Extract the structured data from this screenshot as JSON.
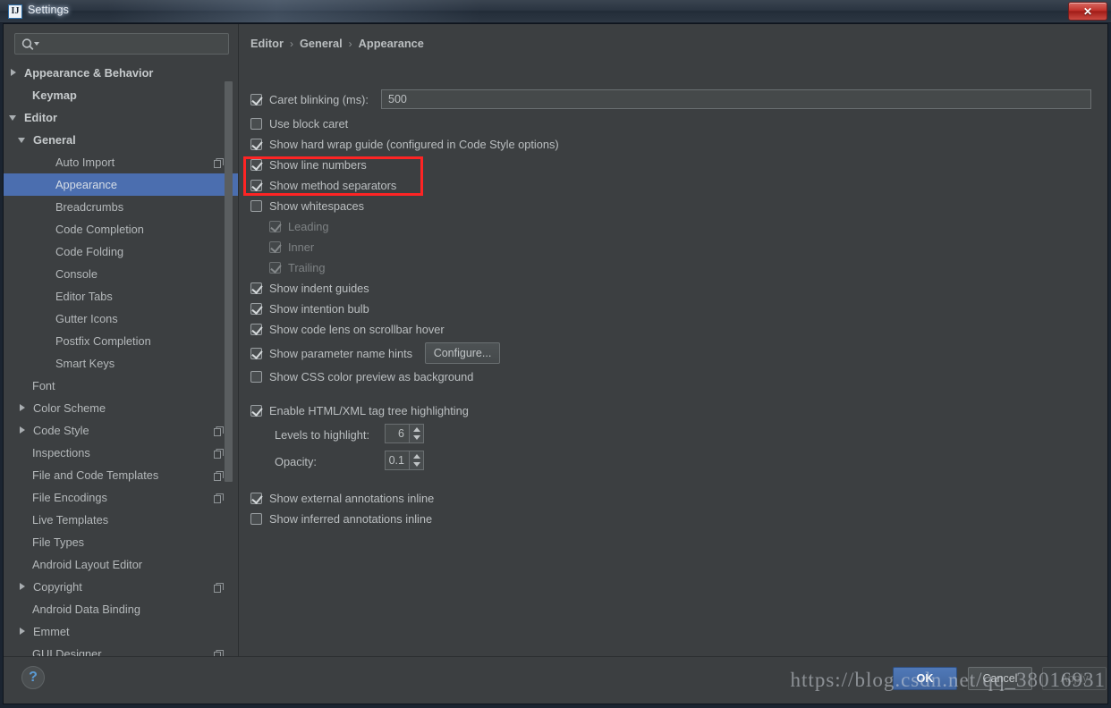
{
  "window": {
    "title": "Settings",
    "app_icon": "intellij-idea-icon",
    "close_label": "✕"
  },
  "search": {
    "value": "",
    "placeholder": "",
    "icon": "search-icon"
  },
  "sidebar": {
    "items": [
      {
        "label": "Appearance & Behavior",
        "indent": 0,
        "arrow": "right",
        "bold": true,
        "selected": false,
        "copy": false
      },
      {
        "label": "Keymap",
        "indent": 1,
        "arrow": "none",
        "bold": true,
        "selected": false,
        "copy": false
      },
      {
        "label": "Editor",
        "indent": 0,
        "arrow": "down",
        "bold": true,
        "selected": false,
        "copy": false
      },
      {
        "label": "General",
        "indent": 1,
        "arrow": "down",
        "bold": true,
        "selected": false,
        "copy": false
      },
      {
        "label": "Auto Import",
        "indent": 2,
        "arrow": "none",
        "bold": false,
        "selected": false,
        "copy": true
      },
      {
        "label": "Appearance",
        "indent": 2,
        "arrow": "none",
        "bold": false,
        "selected": true,
        "copy": false
      },
      {
        "label": "Breadcrumbs",
        "indent": 2,
        "arrow": "none",
        "bold": false,
        "selected": false,
        "copy": false
      },
      {
        "label": "Code Completion",
        "indent": 2,
        "arrow": "none",
        "bold": false,
        "selected": false,
        "copy": false
      },
      {
        "label": "Code Folding",
        "indent": 2,
        "arrow": "none",
        "bold": false,
        "selected": false,
        "copy": false
      },
      {
        "label": "Console",
        "indent": 2,
        "arrow": "none",
        "bold": false,
        "selected": false,
        "copy": false
      },
      {
        "label": "Editor Tabs",
        "indent": 2,
        "arrow": "none",
        "bold": false,
        "selected": false,
        "copy": false
      },
      {
        "label": "Gutter Icons",
        "indent": 2,
        "arrow": "none",
        "bold": false,
        "selected": false,
        "copy": false
      },
      {
        "label": "Postfix Completion",
        "indent": 2,
        "arrow": "none",
        "bold": false,
        "selected": false,
        "copy": false
      },
      {
        "label": "Smart Keys",
        "indent": 2,
        "arrow": "none",
        "bold": false,
        "selected": false,
        "copy": false
      },
      {
        "label": "Font",
        "indent": 1,
        "arrow": "none",
        "bold": false,
        "selected": false,
        "copy": false
      },
      {
        "label": "Color Scheme",
        "indent": 1,
        "arrow": "right",
        "bold": false,
        "selected": false,
        "copy": false
      },
      {
        "label": "Code Style",
        "indent": 1,
        "arrow": "right",
        "bold": false,
        "selected": false,
        "copy": true
      },
      {
        "label": "Inspections",
        "indent": 1,
        "arrow": "none",
        "bold": false,
        "selected": false,
        "copy": true
      },
      {
        "label": "File and Code Templates",
        "indent": 1,
        "arrow": "none",
        "bold": false,
        "selected": false,
        "copy": true
      },
      {
        "label": "File Encodings",
        "indent": 1,
        "arrow": "none",
        "bold": false,
        "selected": false,
        "copy": true
      },
      {
        "label": "Live Templates",
        "indent": 1,
        "arrow": "none",
        "bold": false,
        "selected": false,
        "copy": false
      },
      {
        "label": "File Types",
        "indent": 1,
        "arrow": "none",
        "bold": false,
        "selected": false,
        "copy": false
      },
      {
        "label": "Android Layout Editor",
        "indent": 1,
        "arrow": "none",
        "bold": false,
        "selected": false,
        "copy": false
      },
      {
        "label": "Copyright",
        "indent": 1,
        "arrow": "right",
        "bold": false,
        "selected": false,
        "copy": true
      },
      {
        "label": "Android Data Binding",
        "indent": 1,
        "arrow": "none",
        "bold": false,
        "selected": false,
        "copy": false
      },
      {
        "label": "Emmet",
        "indent": 1,
        "arrow": "right",
        "bold": false,
        "selected": false,
        "copy": false
      },
      {
        "label": "GUI Designer",
        "indent": 1,
        "arrow": "none",
        "bold": false,
        "selected": false,
        "copy": true
      }
    ]
  },
  "breadcrumb": {
    "parts": [
      "Editor",
      "General",
      "Appearance"
    ],
    "separator": "›"
  },
  "main": {
    "caret_blinking": {
      "label": "Caret blinking (ms):",
      "checked": true,
      "value": "500"
    },
    "use_block_caret": {
      "label": "Use block caret",
      "checked": false
    },
    "show_hard_wrap_guide": {
      "label": "Show hard wrap guide (configured in Code Style options)",
      "checked": true
    },
    "show_line_numbers": {
      "label": "Show line numbers",
      "checked": true
    },
    "show_method_separators": {
      "label": "Show method separators",
      "checked": true
    },
    "show_whitespaces": {
      "label": "Show whitespaces",
      "checked": false
    },
    "leading": {
      "label": "Leading",
      "checked": true,
      "disabled": true
    },
    "inner": {
      "label": "Inner",
      "checked": true,
      "disabled": true
    },
    "trailing": {
      "label": "Trailing",
      "checked": true,
      "disabled": true
    },
    "show_indent_guides": {
      "label": "Show indent guides",
      "checked": true
    },
    "show_intention_bulb": {
      "label": "Show intention bulb",
      "checked": true
    },
    "show_code_lens": {
      "label": "Show code lens on scrollbar hover",
      "checked": true
    },
    "show_parameter_hints": {
      "label": "Show parameter name hints",
      "checked": true
    },
    "configure_button": {
      "label": "Configure..."
    },
    "show_css_color_preview": {
      "label": "Show CSS color preview as background",
      "checked": false
    },
    "enable_tag_tree": {
      "label": "Enable HTML/XML tag tree highlighting",
      "checked": true
    },
    "levels_to_highlight": {
      "label": "Levels to highlight:",
      "value": "6"
    },
    "opacity": {
      "label": "Opacity:",
      "value": "0.1"
    },
    "show_external_annotations": {
      "label": "Show external annotations inline",
      "checked": true
    },
    "show_inferred_annotations": {
      "label": "Show inferred annotations inline",
      "checked": false
    }
  },
  "annotation": {
    "color": "#fe2424",
    "surrounds": [
      "Show line numbers",
      "Show method separators"
    ]
  },
  "footer": {
    "help_label": "?",
    "ok_label": "OK",
    "cancel_label": "Cancel",
    "apply_label": "Apply"
  },
  "watermark": {
    "text": "https://blog.csdn.net/qq_38016931"
  }
}
